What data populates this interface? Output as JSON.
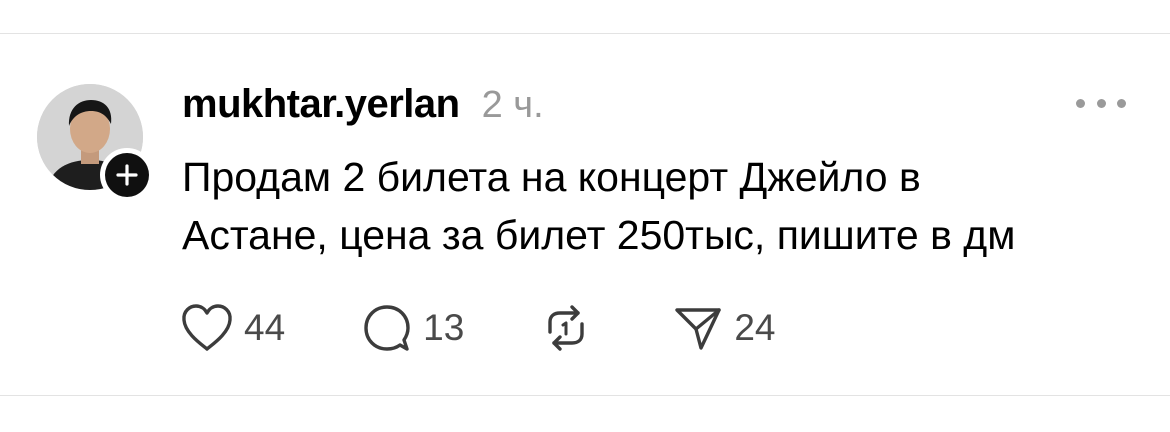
{
  "post": {
    "username": "mukhtar.yerlan",
    "time": "2 ч.",
    "text_lines": [
      "Продам 2 билета на концерт Джейло в",
      "Астане, цена за билет 250тыс, пишите в дм"
    ],
    "likes": "44",
    "replies": "13",
    "shares": "24"
  },
  "icons": {
    "follow": "plus-icon",
    "more": "more-horizontal-icon",
    "like": "heart-icon",
    "reply": "speech-bubble-icon",
    "repost": "repost-icon",
    "share": "send-icon"
  },
  "colors": {
    "text": "#000000",
    "muted": "#999999",
    "count": "#4a4a4a",
    "divider": "#e3e3e3",
    "badge": "#101010"
  }
}
